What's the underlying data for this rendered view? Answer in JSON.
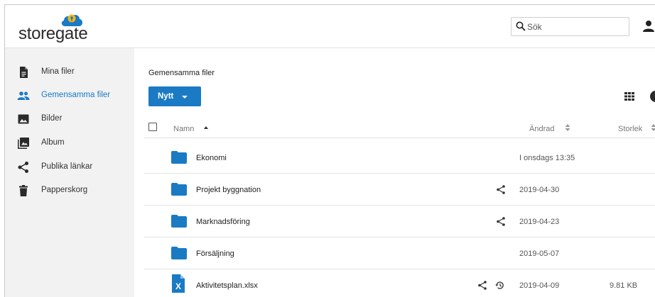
{
  "app": {
    "brand": "storegate",
    "brand_color": "#1a7ac4"
  },
  "header": {
    "search_placeholder": "Sök",
    "icons": [
      "search-icon",
      "user-icon"
    ]
  },
  "sidebar": {
    "items": [
      {
        "label": "Mina filer",
        "icon": "file-icon",
        "active": false
      },
      {
        "label": "Gemensamma filer",
        "icon": "people-icon",
        "active": true
      },
      {
        "label": "Bilder",
        "icon": "image-icon",
        "active": false
      },
      {
        "label": "Album",
        "icon": "album-icon",
        "active": false
      },
      {
        "label": "Publika länkar",
        "icon": "share-icon",
        "active": false
      },
      {
        "label": "Papperskorg",
        "icon": "trash-icon",
        "active": false
      }
    ]
  },
  "main": {
    "breadcrumb": "Gemensamma filer",
    "new_button": "Nytt",
    "columns": {
      "name": "Namn",
      "modified": "Ändrad",
      "size": "Storlek"
    },
    "rows": [
      {
        "name": "Ekonomi",
        "type": "folder",
        "modified": "I onsdags 13:35",
        "size": "",
        "shared": false,
        "history": false
      },
      {
        "name": "Projekt byggnation",
        "type": "folder",
        "modified": "2019-04-30",
        "size": "",
        "shared": true,
        "history": false
      },
      {
        "name": "Marknadsföring",
        "type": "folder",
        "modified": "2019-04-23",
        "size": "",
        "shared": true,
        "history": false
      },
      {
        "name": "Försäljning",
        "type": "folder",
        "modified": "2019-05-07",
        "size": "",
        "shared": false,
        "history": false
      },
      {
        "name": "Aktivitetsplan.xlsx",
        "type": "xlsx",
        "modified": "2019-04-09",
        "size": "9.81 KB",
        "shared": true,
        "history": true
      }
    ]
  }
}
